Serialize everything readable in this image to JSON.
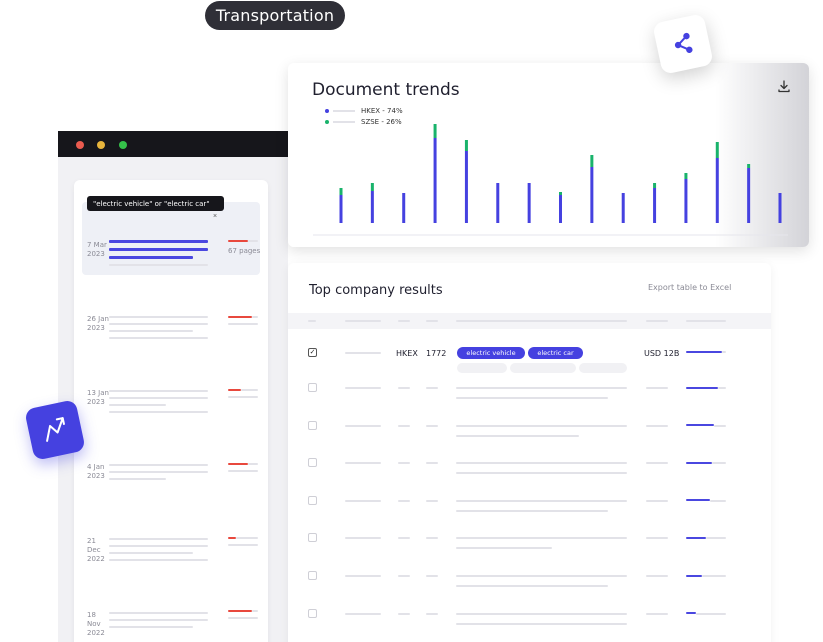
{
  "category_tag": "Transportation",
  "search": {
    "query": "\"electric vehicle\" or \"electric car\"",
    "clear": "×"
  },
  "documents": [
    {
      "date_line1": "7 Mar",
      "date_line2": "2023",
      "pages": "67 pages",
      "selected": true
    },
    {
      "date_line1": "26 Jan",
      "date_line2": "2023"
    },
    {
      "date_line1": "13 Jan",
      "date_line2": "2023"
    },
    {
      "date_line1": "4 Jan",
      "date_line2": "2023"
    },
    {
      "date_line1": "21 Dec",
      "date_line2": "2022"
    },
    {
      "date_line1": "18 Nov",
      "date_line2": "2022"
    }
  ],
  "trends": {
    "title": "Document trends",
    "legend": [
      {
        "label": "HKEX - 74%",
        "color": "#4541e0"
      },
      {
        "label": "SZSE - 26%",
        "color": "#19b36b"
      }
    ]
  },
  "chart_data": {
    "type": "bar",
    "stacked": true,
    "series": [
      {
        "name": "HKEX",
        "color": "#4541e0",
        "values": [
          28,
          32,
          30,
          85,
          72,
          40,
          40,
          28,
          56,
          30,
          35,
          44,
          65,
          55,
          30
        ]
      },
      {
        "name": "SZSE",
        "color": "#19b36b",
        "values": [
          7,
          8,
          0,
          14,
          11,
          0,
          0,
          3,
          12,
          0,
          5,
          6,
          16,
          4,
          0
        ]
      }
    ]
  },
  "results": {
    "title": "Top company results",
    "export_label": "Export table to Excel",
    "first_row": {
      "exchange": "HKEX",
      "code": "1772",
      "chips": [
        "electric vehicle",
        "electric car"
      ],
      "market_cap": "USD 12B",
      "checked": true
    }
  },
  "icons": {
    "trend": "trend-up-icon",
    "share": "share-icon",
    "download": "download-icon"
  }
}
